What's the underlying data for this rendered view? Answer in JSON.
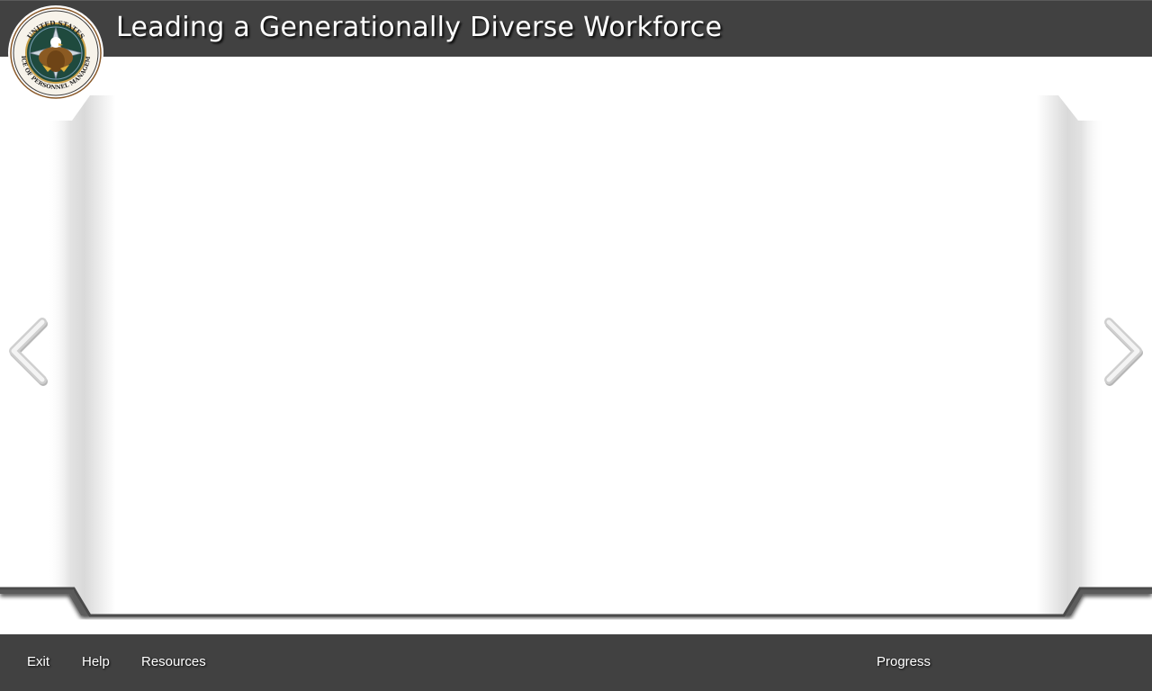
{
  "header": {
    "title": "Leading a Generationally Diverse Workforce",
    "logo": {
      "name": "opm-seal-icon",
      "text_top": "UNITED STATES",
      "text_bottom": "OFFICE OF PERSONNEL MANAGEMENT"
    }
  },
  "navigation": {
    "prev_icon": "chevron-left-icon",
    "next_icon": "chevron-right-icon"
  },
  "footer": {
    "exit_label": "Exit",
    "help_label": "Help",
    "resources_label": "Resources",
    "progress_label": "Progress"
  },
  "colors": {
    "bar_background": "#414141",
    "page_background": "#ffffff",
    "text": "#ffffff"
  }
}
